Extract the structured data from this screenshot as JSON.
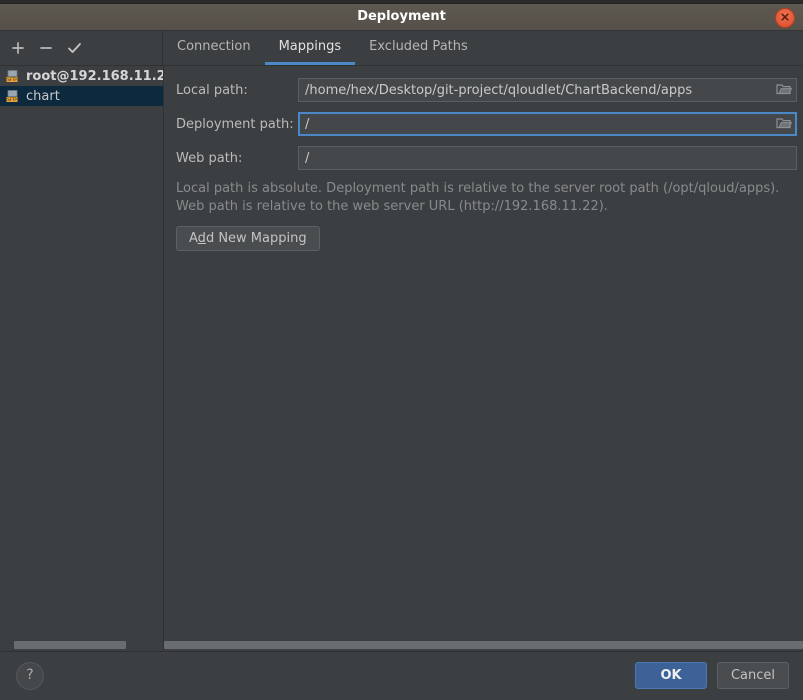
{
  "window": {
    "title": "Deployment",
    "close_icon": "close-icon"
  },
  "toolbar": {
    "add_icon": "plus-icon",
    "remove_icon": "minus-icon",
    "confirm_icon": "check-icon"
  },
  "tabs": [
    {
      "label": "Connection",
      "active": false
    },
    {
      "label": "Mappings",
      "active": true
    },
    {
      "label": "Excluded Paths",
      "active": false
    }
  ],
  "sidebar": {
    "items": [
      {
        "label": "root@192.168.11.2",
        "icon": "sftp-server-icon",
        "selected": false,
        "root": true
      },
      {
        "label": "chart",
        "icon": "sftp-server-icon",
        "selected": true,
        "root": false
      }
    ]
  },
  "mappings": {
    "fields": [
      {
        "label": "Local path:",
        "value": "/home/hex/Desktop/git-project/qloudlet/ChartBackend/apps",
        "placeholder": "",
        "focused": false,
        "has_browse": true,
        "browse_icon": "folder-icon"
      },
      {
        "label": "Deployment path:",
        "value": "/",
        "placeholder": "",
        "focused": true,
        "has_browse": true,
        "browse_icon": "folder-icon"
      },
      {
        "label": "Web path:",
        "value": "/",
        "placeholder": "",
        "focused": false,
        "has_browse": false,
        "browse_icon": ""
      }
    ],
    "hint_line1": "Local path is absolute. Deployment path is relative to the server root path (/opt/qloud/apps).",
    "hint_line2": "Web path is relative to the web server URL (http://192.168.11.22).",
    "add_mapping_label": "Add New Mapping",
    "add_mapping_mnemonic": "d"
  },
  "footer": {
    "help_label": "?",
    "ok_label": "OK",
    "cancel_label": "Cancel"
  },
  "colors": {
    "accent": "#4a88c7",
    "primary_button": "#3c6297",
    "selection": "#0d293e",
    "close_button": "#e25c36",
    "titlebar": "#5c574f",
    "window_bg": "#3c3f41"
  }
}
